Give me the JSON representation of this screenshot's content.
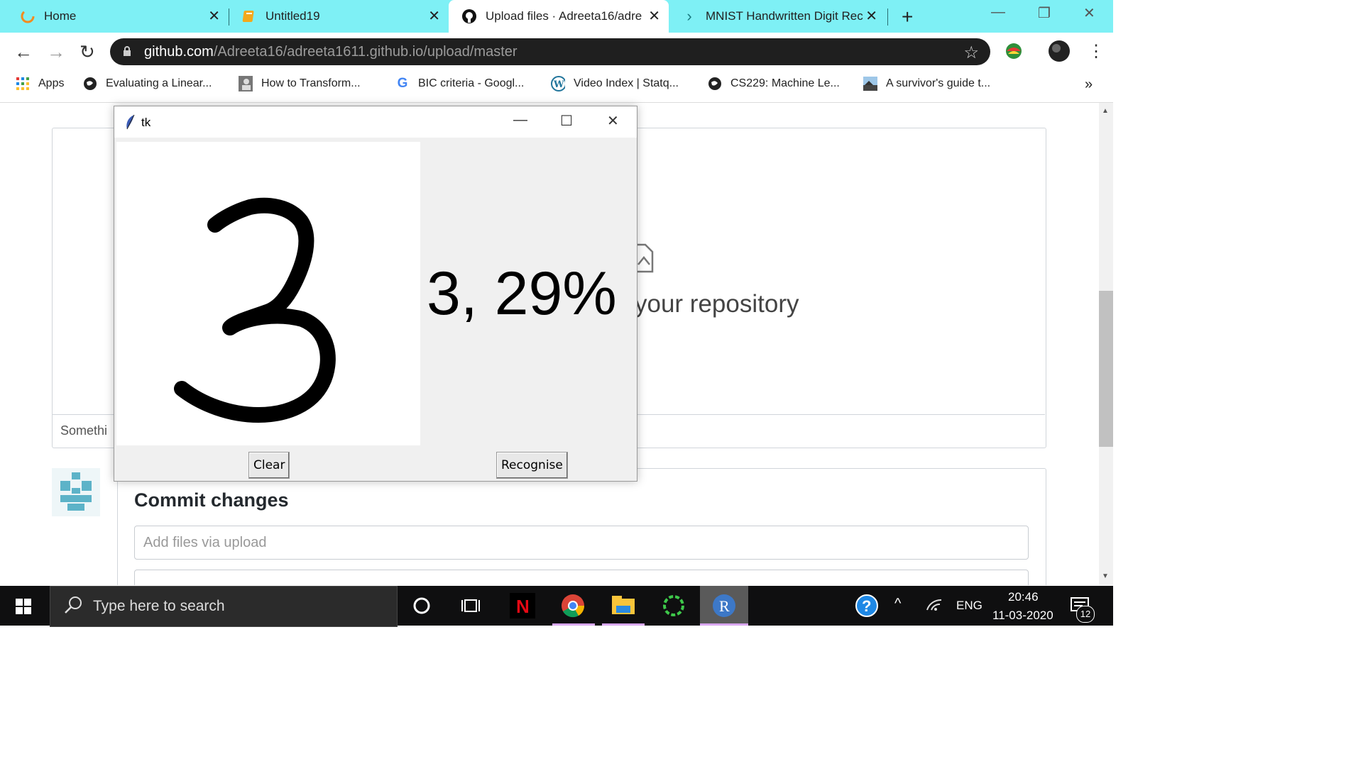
{
  "tabs": [
    {
      "title": "Home",
      "icon": "loading-ring-icon"
    },
    {
      "title": "Untitled19",
      "icon": "notebook-icon"
    },
    {
      "title": "Upload files · Adreeta16/adre",
      "icon": "github-icon"
    },
    {
      "title": "MNIST Handwritten Digit Rec",
      "icon": "chevron-right-icon"
    }
  ],
  "address": {
    "host": "github.com",
    "path": "/Adreeta16/adreeta1611.github.io/upload/master"
  },
  "bookmarks": [
    {
      "label": "Apps"
    },
    {
      "label": "Evaluating a Linear..."
    },
    {
      "label": "How to Transform..."
    },
    {
      "label": "BIC criteria - Googl..."
    },
    {
      "label": "Video Index | Statq..."
    },
    {
      "label": "CS229: Machine Le..."
    },
    {
      "label": "A survivor's guide t..."
    }
  ],
  "bookmarks_more": "»",
  "page": {
    "drop_text": "your repository",
    "drop_footer": "Somethi",
    "commit_title": "Commit changes",
    "commit_placeholder": "Add files via upload"
  },
  "tk": {
    "title": "tk",
    "result": "3, 29%",
    "clear_label": "Clear",
    "recognise_label": "Recognise"
  },
  "taskbar": {
    "search_placeholder": "Type here to search",
    "language": "ENG",
    "time": "20:46",
    "date": "11-03-2020",
    "notification_count": "12"
  }
}
